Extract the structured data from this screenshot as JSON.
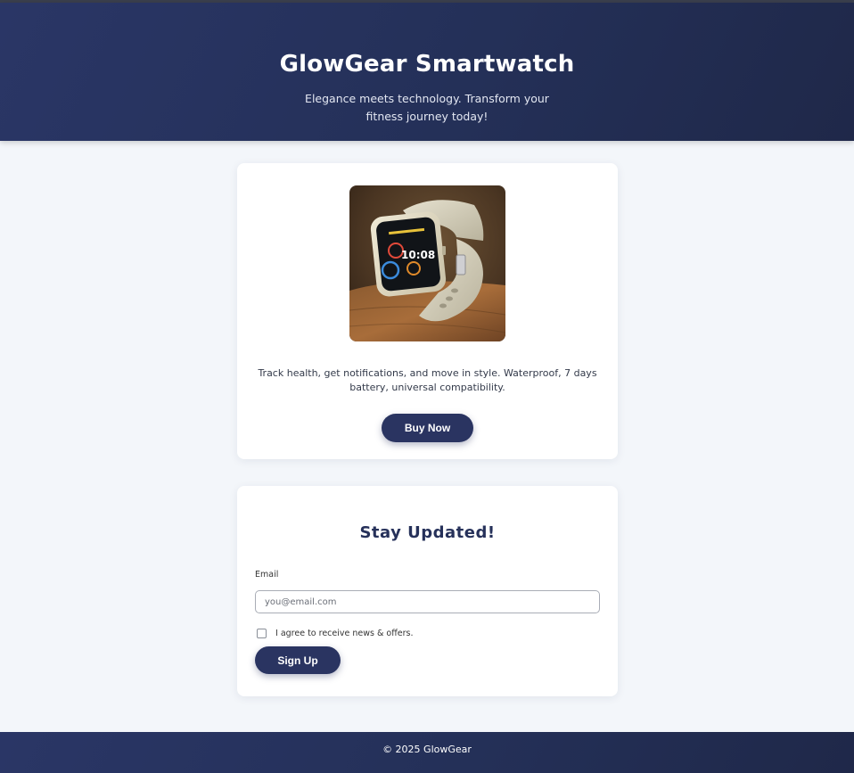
{
  "hero": {
    "title": "GlowGear Smartwatch",
    "tagline": "Elegance meets technology. Transform your fitness journey today!"
  },
  "product": {
    "image_icon": "smartwatch-image",
    "watch_time": "10:08",
    "description": "Track health, get notifications, and move in style. Waterproof, 7 days battery, universal compatibility.",
    "buy_label": "Buy Now"
  },
  "signup": {
    "title": "Stay Updated!",
    "email_label": "Email",
    "email_placeholder": "you@email.com",
    "agree_text": "I agree to receive news & offers.",
    "agree_checked": false,
    "button_label": "Sign Up"
  },
  "footer": {
    "text": "© 2025 GlowGear"
  },
  "colors": {
    "accent": "#2a3461",
    "header_bg": "#26325e",
    "page_bg": "#f3f6fa"
  }
}
